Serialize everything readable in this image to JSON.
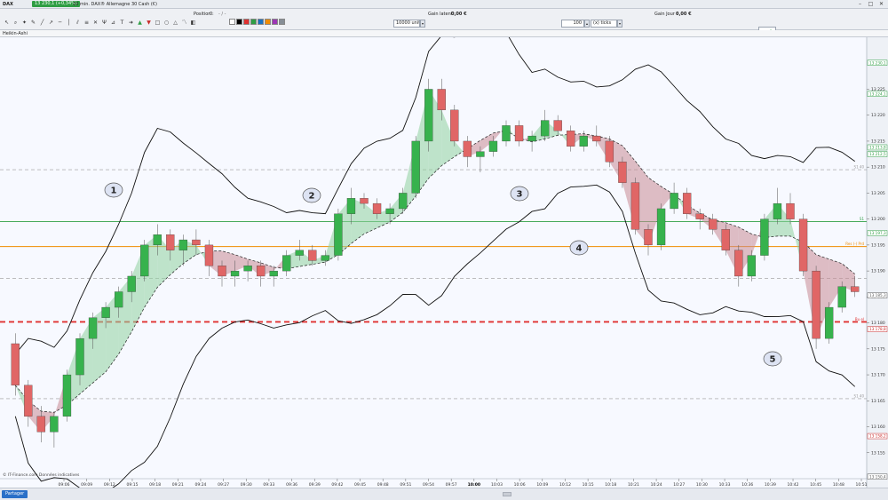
{
  "titlebar": {
    "ticker": "DAX",
    "price": "13 230,1 (+0,34%)",
    "caption": "10 min. DAX® Allemagne 30 Cash (€)",
    "win_min": "–",
    "win_max": "□",
    "win_close": "✕"
  },
  "toolbar": {
    "position_label": "Position :",
    "position_value": "0",
    "position_sep": "- / -",
    "units_value": "10000 unités",
    "gain_latent_label": "Gain latent :",
    "gain_latent_value": "0,00 €",
    "ticks_value": "100",
    "ticks_unit": "(x) ticks",
    "gain_jour_label": "Gain Jour :",
    "gain_jour_value": "0,00 €",
    "icons": [
      "cursor-icon",
      "zoom-icon",
      "star-icon",
      "pencil-icon",
      "line-icon",
      "ray-icon",
      "hline-icon",
      "vline-icon",
      "channel-icon",
      "fibonacci-icon",
      "cross-icon",
      "pitchfork-icon",
      "gann-icon",
      "text-icon",
      "arrow-icon",
      "arrow-up-icon",
      "arrow-down-icon",
      "rect-icon",
      "ellipse-icon",
      "triangle-icon",
      "polyline-icon",
      "palette-icon"
    ],
    "swatches": [
      "#ffffff",
      "#000000",
      "#e03131",
      "#2f9e44",
      "#1971c2",
      "#f08c00",
      "#9c36b5",
      "#868e96"
    ]
  },
  "subbar": {
    "index_label": "Heikin-Ashi"
  },
  "chart_data": {
    "type": "candlestick",
    "instrument": "DAX® Allemagne 30 Cash (€)",
    "timeframe": "10 min.",
    "ylim": [
      13150,
      13235
    ],
    "price_ticks": [
      "13 225",
      "13 220",
      "13 215",
      "13 210",
      "13 205",
      "13 200",
      "13 195",
      "13 190",
      "13 185",
      "13 180",
      "13 175",
      "13 170",
      "13 165",
      "13 160",
      "13 155"
    ],
    "price_tags": [
      {
        "text": "13 230,1",
        "value": 13230.1,
        "color": "#2f9e44"
      },
      {
        "text": "13 224,1",
        "value": 13224.1,
        "color": "#2f9e44"
      },
      {
        "text": "13 213,8",
        "value": 13213.8,
        "color": "#2f9e44"
      },
      {
        "text": "13 212,5",
        "value": 13212.5,
        "color": "#2f9e44"
      },
      {
        "text": "13 197,3",
        "value": 13197.3,
        "color": "#2f9e44"
      },
      {
        "text": "13 185,3",
        "value": 13185.3,
        "color": "#555555"
      },
      {
        "text": "13 178,8",
        "value": 13178.8,
        "color": "#c92a2a"
      },
      {
        "text": "13 158,2",
        "value": 13158.2,
        "color": "#c92a2a"
      },
      {
        "text": "13 150,4",
        "value": 13150.4,
        "color": "#555555"
      }
    ],
    "time_ticks": [
      "09:06",
      "09:09",
      "09:12",
      "09:15",
      "09:18",
      "09:21",
      "09:24",
      "09:27",
      "09:30",
      "09:33",
      "09:36",
      "09:39",
      "09:42",
      "09:45",
      "09:48",
      "09:51",
      "09:54",
      "09:57",
      "10:00",
      "10:03",
      "10:06",
      "10:09",
      "10:12",
      "10:15",
      "10:18",
      "10:21",
      "10:24",
      "10:27",
      "10:30",
      "10:33",
      "10:36",
      "10:39",
      "10:42",
      "10:45",
      "10:48",
      "10:51"
    ],
    "levels": [
      {
        "name": "S1",
        "label": "S1 40",
        "value": 13209.5,
        "color": "#999999",
        "style": "dashed"
      },
      {
        "name": "green",
        "label": "S1",
        "value": 13199.5,
        "color": "#2f9e44",
        "style": "solid"
      },
      {
        "name": "orange",
        "label": "Res (-) Prd",
        "value": 13194.7,
        "color": "#f08c00",
        "style": "solid"
      },
      {
        "name": "pivot",
        "label": "",
        "value": 13188.6,
        "color": "#999999",
        "style": "dashed"
      },
      {
        "name": "red",
        "label": "Bu el",
        "value": 13180.2,
        "color": "#e03131",
        "style": "dashed"
      },
      {
        "name": "S2",
        "label": "S1 40",
        "value": 13165.4,
        "color": "#999999",
        "style": "dashed"
      }
    ],
    "annotations": [
      "1",
      "2",
      "3",
      "4",
      "5"
    ],
    "source_note": "© IT-Finance.com  Données indicatives",
    "candles": [
      [
        13176,
        13178,
        13166,
        13168
      ],
      [
        13168,
        13169,
        13160,
        13162
      ],
      [
        13162,
        13164,
        13157,
        13159
      ],
      [
        13159,
        13163,
        13156,
        13162
      ],
      [
        13162,
        13171,
        13161,
        13170
      ],
      [
        13170,
        13178,
        13168,
        13177
      ],
      [
        13177,
        13182,
        13175,
        13181
      ],
      [
        13181,
        13184,
        13179,
        13183
      ],
      [
        13183,
        13187,
        13181,
        13186
      ],
      [
        13186,
        13190,
        13184,
        13189
      ],
      [
        13189,
        13196,
        13188,
        13195
      ],
      [
        13195,
        13199,
        13193,
        13197
      ],
      [
        13197,
        13198,
        13192,
        13194
      ],
      [
        13194,
        13197,
        13191,
        13196
      ],
      [
        13196,
        13198,
        13193,
        13195
      ],
      [
        13195,
        13196,
        13189,
        13191
      ],
      [
        13191,
        13192,
        13187,
        13189
      ],
      [
        13189,
        13192,
        13187,
        13190
      ],
      [
        13190,
        13192,
        13188,
        13191
      ],
      [
        13191,
        13192,
        13187,
        13189
      ],
      [
        13189,
        13191,
        13187,
        13190
      ],
      [
        13190,
        13194,
        13189,
        13193
      ],
      [
        13193,
        13196,
        13192,
        13194
      ],
      [
        13194,
        13195,
        13191,
        13192
      ],
      [
        13192,
        13194,
        13191,
        13193
      ],
      [
        13193,
        13202,
        13192,
        13201
      ],
      [
        13201,
        13206,
        13199,
        13204
      ],
      [
        13204,
        13205,
        13202,
        13203
      ],
      [
        13203,
        13204,
        13200,
        13201
      ],
      [
        13201,
        13203,
        13199,
        13202
      ],
      [
        13202,
        13206,
        13201,
        13205
      ],
      [
        13205,
        13216,
        13204,
        13215
      ],
      [
        13215,
        13227,
        13213,
        13225
      ],
      [
        13225,
        13227,
        13219,
        13221
      ],
      [
        13221,
        13222,
        13214,
        13215
      ],
      [
        13215,
        13216,
        13210,
        13212
      ],
      [
        13212,
        13214,
        13209,
        13213
      ],
      [
        13213,
        13216,
        13212,
        13215
      ],
      [
        13215,
        13219,
        13214,
        13218
      ],
      [
        13218,
        13219,
        13214,
        13215
      ],
      [
        13215,
        13217,
        13213,
        13216
      ],
      [
        13216,
        13221,
        13215,
        13219
      ],
      [
        13219,
        13220,
        13216,
        13217
      ],
      [
        13217,
        13218,
        13213,
        13214
      ],
      [
        13214,
        13217,
        13213,
        13216
      ],
      [
        13216,
        13218,
        13214,
        13215
      ],
      [
        13215,
        13216,
        13210,
        13211
      ],
      [
        13211,
        13212,
        13206,
        13207
      ],
      [
        13207,
        13208,
        13197,
        13198
      ],
      [
        13198,
        13199,
        13193,
        13195
      ],
      [
        13195,
        13203,
        13194,
        13202
      ],
      [
        13202,
        13207,
        13201,
        13205
      ],
      [
        13205,
        13206,
        13200,
        13201
      ],
      [
        13201,
        13202,
        13198,
        13200
      ],
      [
        13200,
        13201,
        13197,
        13198
      ],
      [
        13198,
        13199,
        13193,
        13194
      ],
      [
        13194,
        13195,
        13187,
        13189
      ],
      [
        13189,
        13194,
        13188,
        13193
      ],
      [
        13193,
        13201,
        13192,
        13200
      ],
      [
        13200,
        13206,
        13199,
        13203
      ],
      [
        13203,
        13205,
        13199,
        13200
      ],
      [
        13200,
        13201,
        13189,
        13190
      ],
      [
        13190,
        13191,
        13175,
        13177
      ],
      [
        13177,
        13184,
        13176,
        13183
      ],
      [
        13183,
        13188,
        13182,
        13187
      ],
      [
        13187,
        13189,
        13185,
        13186
      ]
    ]
  },
  "statusbar": {
    "share_label": "Partager"
  }
}
